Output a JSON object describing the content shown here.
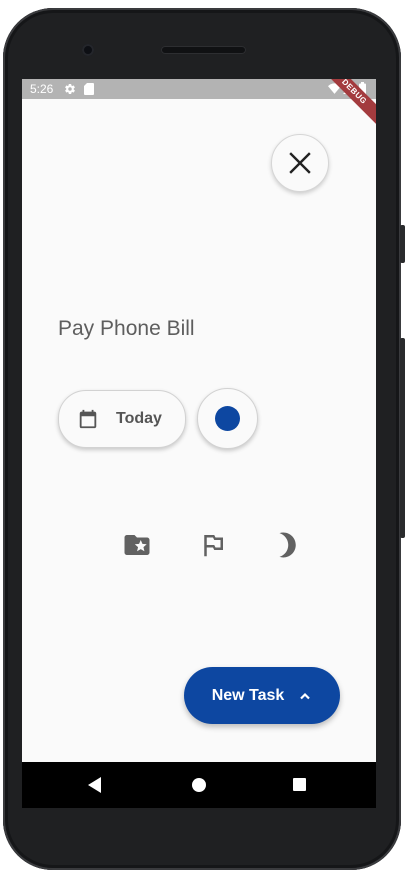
{
  "statusbar": {
    "time": "5:26",
    "icons": [
      "settings-icon",
      "sd-card-icon",
      "wifi-icon",
      "signal-icon",
      "battery-icon"
    ],
    "debug_banner": "DEBUG"
  },
  "task": {
    "title": "Pay Phone Bill",
    "date_label": "Today",
    "color": "#0d47a1"
  },
  "actions": [
    "folder-star-icon",
    "flag-icon",
    "moon-icon"
  ],
  "fab": {
    "label": "New Task",
    "color": "#0d47a1"
  },
  "navbar": [
    "back",
    "home",
    "recents"
  ],
  "colors": {
    "background": "#fafafa",
    "statusbar": "#b3b3b3",
    "accent": "#0d47a1",
    "icon": "#616161"
  }
}
